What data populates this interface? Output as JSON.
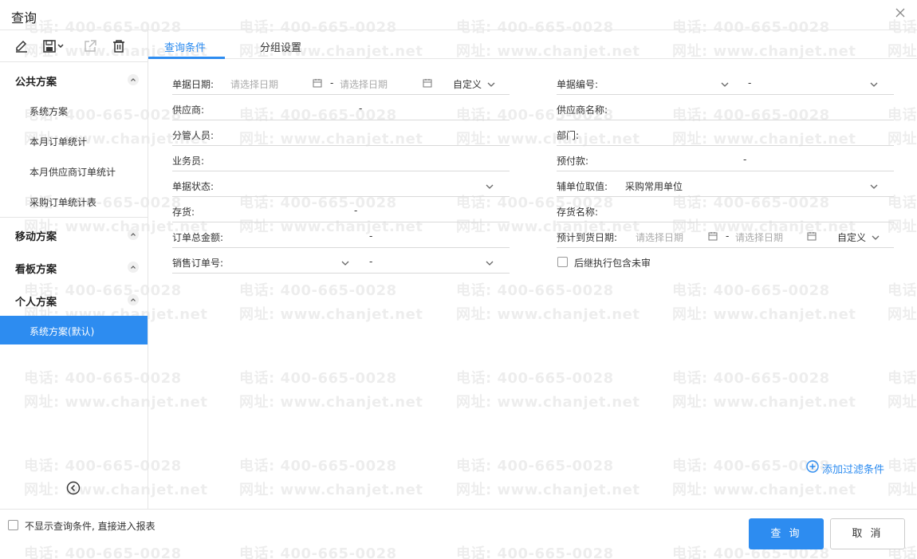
{
  "title": "查询",
  "watermark": {
    "phone": "电话: 400-665-0028",
    "site": "网址: www.chanjet.net"
  },
  "sidebar": {
    "toolbar": [
      "edit-icon",
      "save-icon",
      "export-icon",
      "delete-icon"
    ],
    "sections": {
      "public": {
        "label": "公共方案",
        "items": [
          "系统方案",
          "本月订单统计",
          "本月供应商订单统计",
          "采购订单统计表"
        ]
      },
      "mobile": {
        "label": "移动方案"
      },
      "board": {
        "label": "看板方案"
      },
      "personal": {
        "label": "个人方案",
        "items": [
          "系统方案(默认)"
        ]
      }
    }
  },
  "tabs": [
    {
      "label": "查询条件",
      "active": true
    },
    {
      "label": "分组设置",
      "active": false
    }
  ],
  "form": {
    "doc_date": {
      "label": "单据日期:",
      "start_placeholder": "请选择日期",
      "end_placeholder": "请选择日期",
      "dash": "-",
      "mode": "自定义"
    },
    "doc_no": {
      "label": "单据编号:",
      "dash": "-"
    },
    "supplier": {
      "label": "供应商:",
      "dash": "-"
    },
    "supplier_name": {
      "label": "供应商名称:"
    },
    "manager": {
      "label": "分管人员:"
    },
    "department": {
      "label": "部门:"
    },
    "salesman": {
      "label": "业务员:"
    },
    "prepay": {
      "label": "预付款:",
      "dash": "-"
    },
    "doc_status": {
      "label": "单据状态:"
    },
    "aux_unit": {
      "label": "辅单位取值:",
      "value": "采购常用单位"
    },
    "inventory": {
      "label": "存货:",
      "dash": "-"
    },
    "inventory_name": {
      "label": "存货名称:"
    },
    "order_total": {
      "label": "订单总金额:",
      "dash": "-"
    },
    "arrival_date": {
      "label": "预计到货日期:",
      "start_placeholder": "请选择日期",
      "end_placeholder": "请选择日期",
      "dash": "-",
      "mode": "自定义"
    },
    "sales_order": {
      "label": "销售订单号:",
      "dash": "-"
    },
    "include_unreviewed": {
      "label": "后继执行包含未审",
      "checked": false
    }
  },
  "add_filter": "添加过滤条件",
  "footer": {
    "skip_label": "不显示查询条件, 直接进入报表",
    "query": "查 询",
    "cancel": "取 消"
  },
  "colors": {
    "accent": "#2d8cf0"
  }
}
